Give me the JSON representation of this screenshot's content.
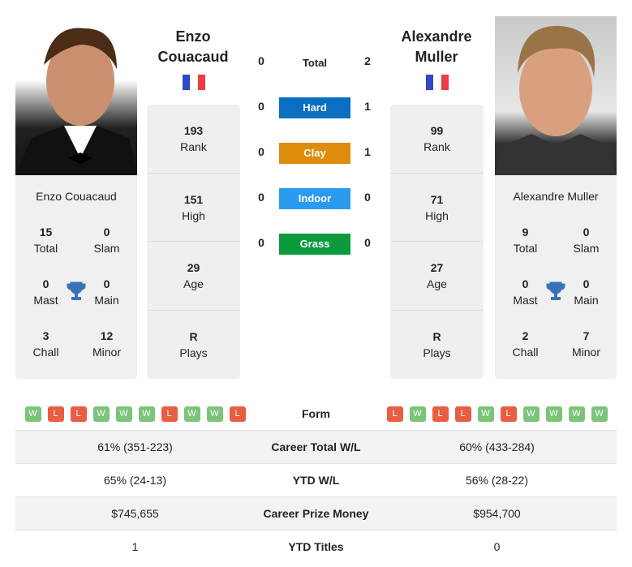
{
  "colors": {
    "hard": "#0a6fc2",
    "clay": "#dd8c0b",
    "indoor": "#2b9bf0",
    "grass": "#0b9a3c",
    "win": "#7cc47a",
    "loss": "#e95d43"
  },
  "p1": {
    "name_line1": "Enzo",
    "name_line2": "Couacaud",
    "full_name": "Enzo Couacaud",
    "flag": "France",
    "total": "15",
    "total_label": "Total",
    "slam": "0",
    "slam_label": "Slam",
    "mast": "0",
    "mast_label": "Mast",
    "main": "0",
    "main_label": "Main",
    "chall": "3",
    "chall_label": "Chall",
    "minor": "12",
    "minor_label": "Minor",
    "rank": "193",
    "rank_label": "Rank",
    "high": "151",
    "high_label": "High",
    "age": "29",
    "age_label": "Age",
    "plays": "R",
    "plays_label": "Plays",
    "form": [
      "W",
      "L",
      "L",
      "W",
      "W",
      "W",
      "L",
      "W",
      "W",
      "L"
    ]
  },
  "p2": {
    "name_line1": "Alexandre",
    "name_line2": "Muller",
    "full_name": "Alexandre Muller",
    "flag": "France",
    "total": "9",
    "total_label": "Total",
    "slam": "0",
    "slam_label": "Slam",
    "mast": "0",
    "mast_label": "Mast",
    "main": "0",
    "main_label": "Main",
    "chall": "2",
    "chall_label": "Chall",
    "minor": "7",
    "minor_label": "Minor",
    "rank": "99",
    "rank_label": "Rank",
    "high": "71",
    "high_label": "High",
    "age": "27",
    "age_label": "Age",
    "plays": "R",
    "plays_label": "Plays",
    "form": [
      "L",
      "W",
      "L",
      "L",
      "W",
      "L",
      "W",
      "W",
      "W",
      "W"
    ]
  },
  "h2h": [
    {
      "label": "Total",
      "p1": "0",
      "p2": "2"
    },
    {
      "label": "Hard",
      "p1": "0",
      "p2": "1"
    },
    {
      "label": "Clay",
      "p1": "0",
      "p2": "1"
    },
    {
      "label": "Indoor",
      "p1": "0",
      "p2": "0"
    },
    {
      "label": "Grass",
      "p1": "0",
      "p2": "0"
    }
  ],
  "table": {
    "form_label": "Form",
    "rows": [
      {
        "label": "Career Total W/L",
        "p1": "61% (351-223)",
        "p2": "60% (433-284)"
      },
      {
        "label": "YTD W/L",
        "p1": "65% (24-13)",
        "p2": "56% (28-22)"
      },
      {
        "label": "Career Prize Money",
        "p1": "$745,655",
        "p2": "$954,700"
      },
      {
        "label": "YTD Titles",
        "p1": "1",
        "p2": "0"
      }
    ]
  }
}
